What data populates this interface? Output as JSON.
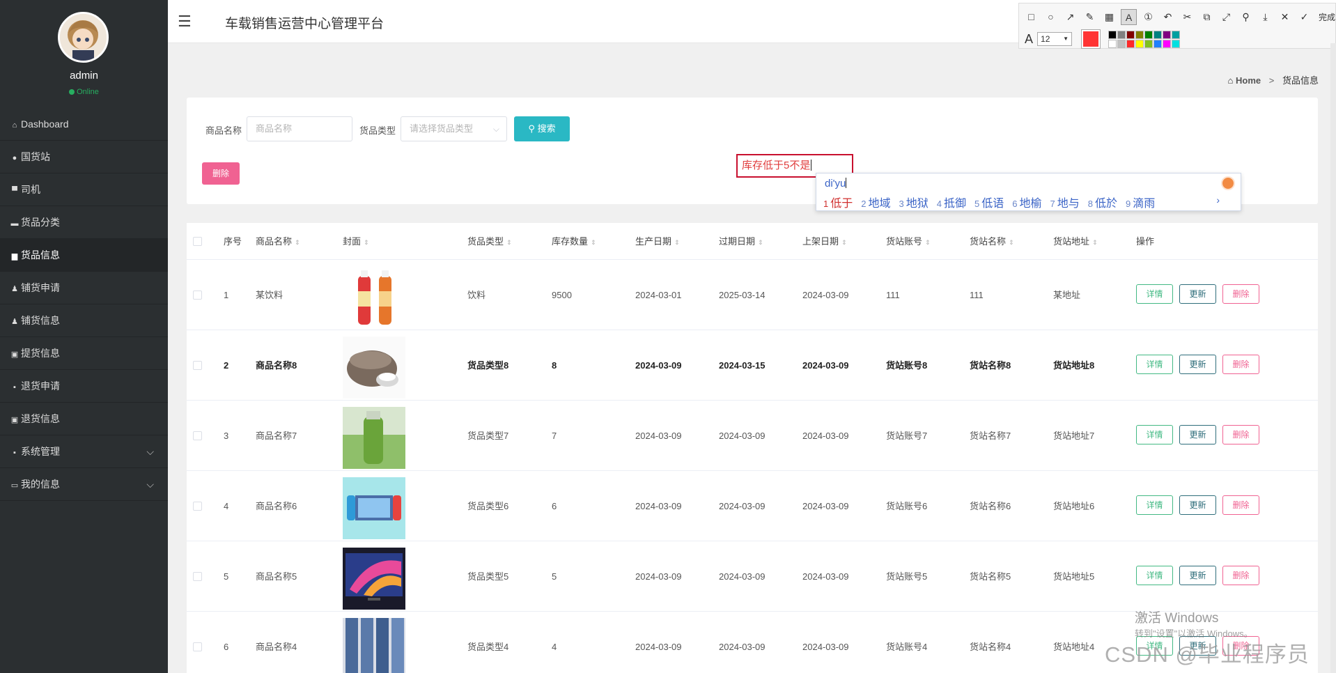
{
  "sidebar": {
    "user": {
      "name": "admin",
      "status": "Online"
    },
    "items": [
      {
        "label": "Dashboard",
        "icon": "home-icon",
        "glyph": "⌂"
      },
      {
        "label": "国货站",
        "icon": "location-icon",
        "glyph": "●"
      },
      {
        "label": "司机",
        "icon": "chat-icon",
        "glyph": "▀"
      },
      {
        "label": "货品分类",
        "icon": "folder-icon",
        "glyph": "▬"
      },
      {
        "label": "货品信息",
        "icon": "book-icon",
        "glyph": "▆",
        "active": true
      },
      {
        "label": "铺货申请",
        "icon": "user-icon",
        "glyph": "♟"
      },
      {
        "label": "铺货信息",
        "icon": "user-icon",
        "glyph": "♟"
      },
      {
        "label": "提货信息",
        "icon": "briefcase-icon",
        "glyph": "▣"
      },
      {
        "label": "退货申请",
        "icon": "grid-icon",
        "glyph": "▪"
      },
      {
        "label": "退货信息",
        "icon": "briefcase-icon",
        "glyph": "▣"
      },
      {
        "label": "系统管理",
        "icon": "grid-icon",
        "glyph": "▪",
        "expandable": true
      },
      {
        "label": "我的信息",
        "icon": "card-icon",
        "glyph": "▭",
        "expandable": true
      }
    ]
  },
  "header": {
    "title": "车载销售运营中心管理平台"
  },
  "snip_toolbar": {
    "done_label": "完成",
    "font_size": "12",
    "current_color": "#ff3434",
    "palette": [
      "#000000",
      "#808080",
      "#800000",
      "#808000",
      "#008000",
      "#008080",
      "#800080",
      "#00a0a0",
      "#ffffff",
      "#c0c0c0",
      "#ff2a2a",
      "#ffff00",
      "#80c020",
      "#2080ff",
      "#ff00ff",
      "#00e0e0"
    ]
  },
  "breadcrumb": {
    "home": "Home",
    "current": "货品信息"
  },
  "search": {
    "name_label": "商品名称",
    "name_placeholder": "商品名称",
    "type_label": "货品类型",
    "type_placeholder": "请选择货品类型",
    "search_button": "搜索",
    "delete_button": "删除"
  },
  "annotation": {
    "text": "库存低于5不是"
  },
  "ime": {
    "composition": "di'yu",
    "candidates": [
      {
        "n": "1",
        "text": "低于"
      },
      {
        "n": "2",
        "text": "地域"
      },
      {
        "n": "3",
        "text": "地狱"
      },
      {
        "n": "4",
        "text": "抵御"
      },
      {
        "n": "5",
        "text": "低语"
      },
      {
        "n": "6",
        "text": "地榆"
      },
      {
        "n": "7",
        "text": "地与"
      },
      {
        "n": "8",
        "text": "低於"
      },
      {
        "n": "9",
        "text": "滴雨"
      }
    ]
  },
  "table": {
    "columns": [
      "序号",
      "商品名称",
      "封面",
      "货品类型",
      "库存数量",
      "生产日期",
      "过期日期",
      "上架日期",
      "货站账号",
      "货站名称",
      "货站地址",
      "操作"
    ],
    "actions": {
      "detail": "详情",
      "update": "更新",
      "delete": "删除"
    },
    "rows": [
      {
        "index": "1",
        "name": "某饮料",
        "cover": "drink-bottles",
        "type": "饮料",
        "stock": "9500",
        "produced": "2024-03-01",
        "expires": "2025-03-14",
        "listed": "2024-03-09",
        "account": "111",
        "station": "111",
        "address": "某地址"
      },
      {
        "index": "2",
        "name": "商品名称8",
        "cover": "rice-cooker",
        "type": "货品类型8",
        "stock": "8",
        "produced": "2024-03-09",
        "expires": "2024-03-15",
        "listed": "2024-03-09",
        "account": "货站账号8",
        "station": "货站名称8",
        "address": "货站地址8",
        "bold": true
      },
      {
        "index": "3",
        "name": "商品名称7",
        "cover": "green-bottle",
        "type": "货品类型7",
        "stock": "7",
        "produced": "2024-03-09",
        "expires": "2024-03-09",
        "listed": "2024-03-09",
        "account": "货站账号7",
        "station": "货站名称7",
        "address": "货站地址7"
      },
      {
        "index": "4",
        "name": "商品名称6",
        "cover": "game-console",
        "type": "货品类型6",
        "stock": "6",
        "produced": "2024-03-09",
        "expires": "2024-03-09",
        "listed": "2024-03-09",
        "account": "货站账号6",
        "station": "货站名称6",
        "address": "货站地址6"
      },
      {
        "index": "5",
        "name": "商品名称5",
        "cover": "television",
        "type": "货品类型5",
        "stock": "5",
        "produced": "2024-03-09",
        "expires": "2024-03-09",
        "listed": "2024-03-09",
        "account": "货站账号5",
        "station": "货站名称5",
        "address": "货站地址5"
      },
      {
        "index": "6",
        "name": "商品名称4",
        "cover": "jeans",
        "type": "货品类型4",
        "stock": "4",
        "produced": "2024-03-09",
        "expires": "2024-03-09",
        "listed": "2024-03-09",
        "account": "货站账号4",
        "station": "货站名称4",
        "address": "货站地址4"
      }
    ]
  },
  "watermarks": {
    "windows_title": "激活 Windows",
    "windows_sub": "转到\"设置\"以激活 Windows。",
    "csdn": "CSDN @毕业程序员"
  }
}
